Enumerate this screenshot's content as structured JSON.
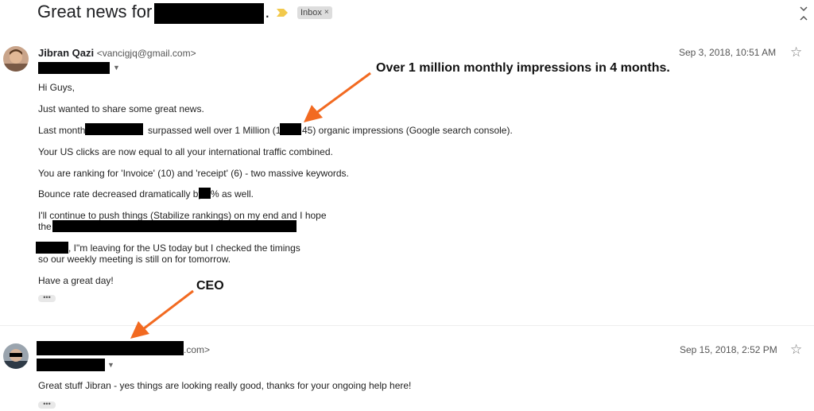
{
  "thread": {
    "subject_prefix": "Great news for",
    "subject_suffix": ".",
    "label": "Inbox",
    "label_remove": "×"
  },
  "message1": {
    "sender_name": "Jibran Qazi",
    "sender_email": "<vancigjq@gmail.com>",
    "date": "Sep 3, 2018, 10:51 AM",
    "lines": {
      "greeting": "Hi Guys,",
      "p1": "Just wanted to share some great news.",
      "p2_a": "Last month",
      "p2_b": "surpassed well over 1 Million (1,",
      "p2_c": "45) organic impressions (Google search console).",
      "p3": "Your US clicks are now equal to all your international traffic combined.",
      "p4": "You are ranking for 'Invoice' (10) and 'receipt' (6) - two massive keywords.",
      "p5_a": "Bounce rate decreased dramatically by",
      "p5_b": "% as well.",
      "p6_l1": "I'll continue to push things (Stabilize rankings) on my end and I hope",
      "p6_l2": "the",
      "p7_l1": ", I\"m leaving for the US today but I checked the timings",
      "p7_l2": "so our weekly meeting is still on for tomorrow.",
      "closing": "Have a great day!"
    }
  },
  "message2": {
    "sender_email_suffix": ".com>",
    "date": "Sep 15, 2018, 2:52 PM",
    "body": "Great stuff Jibran - yes things are looking really good, thanks for your ongoing help here!"
  },
  "annotations": {
    "impressions": "Over 1 million monthly impressions in 4 months.",
    "ceo": "CEO"
  },
  "more_label": "•••",
  "colors": {
    "arrow": "#f26a21",
    "label_chip": "#dddddd",
    "tag_icon": "#f2c94c"
  },
  "icons": [
    "important-tag-icon",
    "expand-collapse-icon",
    "star-icon",
    "caret-down-icon"
  ]
}
